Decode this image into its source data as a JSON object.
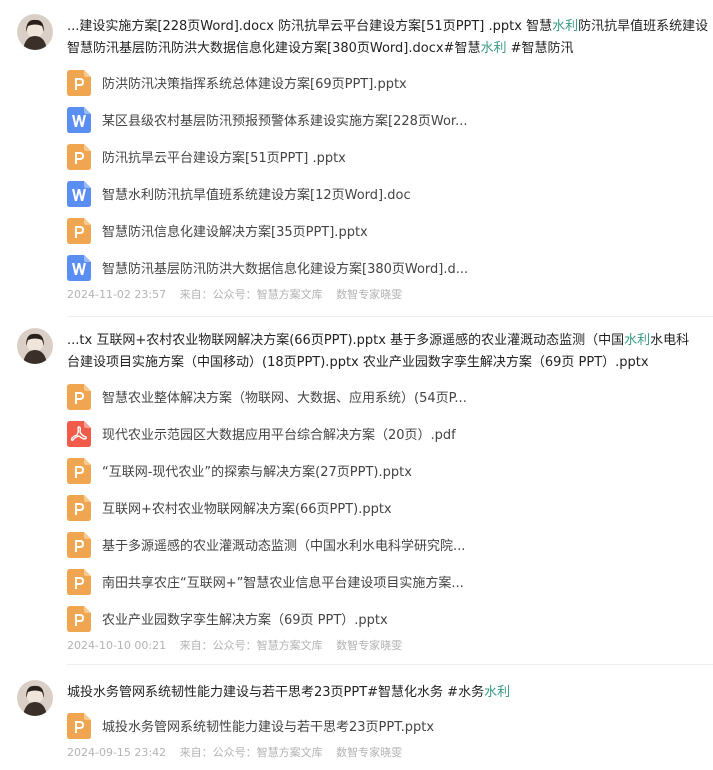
{
  "posts": [
    {
      "desc_line1": [
        "...建设实施方案[228页Word].docx 防汛抗旱云平台建设方案[51页PPT] .pptx 智慧",
        "水利",
        "防汛抗旱值班系统建设"
      ],
      "desc_line2": [
        "智慧防汛基层防汛防洪大数据信息化建设方案[380页Word].docx#智慧",
        "水利",
        "  #智慧防汛"
      ],
      "files": [
        {
          "type": "ppt",
          "name": "防洪防汛决策指挥系统总体建设方案[69页PPT].pptx"
        },
        {
          "type": "word",
          "name": "某区县级农村基层防汛预报预警体系建设实施方案[228页Wor..."
        },
        {
          "type": "ppt",
          "name": "防汛抗旱云平台建设方案[51页PPT] .pptx"
        },
        {
          "type": "word",
          "name": "智慧水利防汛抗旱值班系统建设方案[12页Word].doc"
        },
        {
          "type": "ppt",
          "name": "智慧防汛信息化建设解决方案[35页PPT].pptx"
        },
        {
          "type": "word",
          "name": "智慧防汛基层防汛防洪大数据信息化建设方案[380页Word].d..."
        }
      ],
      "date": "2024-11-02 23:57",
      "source": "来自：公众号：智慧方案文库",
      "tag": "数智专家晓雯"
    },
    {
      "desc_line1": [
        "...tx 互联网+农村农业物联网解决方案(66页PPT).pptx 基于多源遥感的农业灌溉动态监测（中国",
        "水利",
        "水电科"
      ],
      "desc_line2": [
        "台建设项目实施方案（中国移动）(18页PPT).pptx 农业产业园数字孪生解决方案（69页 PPT）.pptx",
        "",
        ""
      ],
      "files": [
        {
          "type": "ppt",
          "name": "智慧农业整体解决方案（物联网、大数据、应用系统）(54页P..."
        },
        {
          "type": "pdf",
          "name": "现代农业示范园区大数据应用平台综合解决方案（20页）.pdf"
        },
        {
          "type": "ppt",
          "name": "“互联网-现代农业”的探索与解决方案(27页PPT).pptx"
        },
        {
          "type": "ppt",
          "name": "互联网+农村农业物联网解决方案(66页PPT).pptx"
        },
        {
          "type": "ppt",
          "name": "基于多源遥感的农业灌溉动态监测（中国水利水电科学研究院..."
        },
        {
          "type": "ppt",
          "name": "南田共享农庄“互联网+”智慧农业信息平台建设项目实施方案..."
        },
        {
          "type": "ppt",
          "name": "农业产业园数字孪生解决方案（69页 PPT）.pptx"
        }
      ],
      "date": "2024-10-10 00:21",
      "source": "来自：公众号：智慧方案文库",
      "tag": "数智专家晓雯"
    },
    {
      "desc_line1": [
        "城投水务管网系统韧性能力建设与若干思考23页PPT#智慧化水务  #水务",
        "水利",
        ""
      ],
      "desc_line2": [
        "",
        "",
        ""
      ],
      "files": [
        {
          "type": "ppt",
          "name": "城投水务管网系统韧性能力建设与若干思考23页PPT.pptx"
        }
      ],
      "date": "2024-09-15 23:42",
      "source": "来自：公众号：智慧方案文库",
      "tag": "数智专家晓雯"
    }
  ]
}
